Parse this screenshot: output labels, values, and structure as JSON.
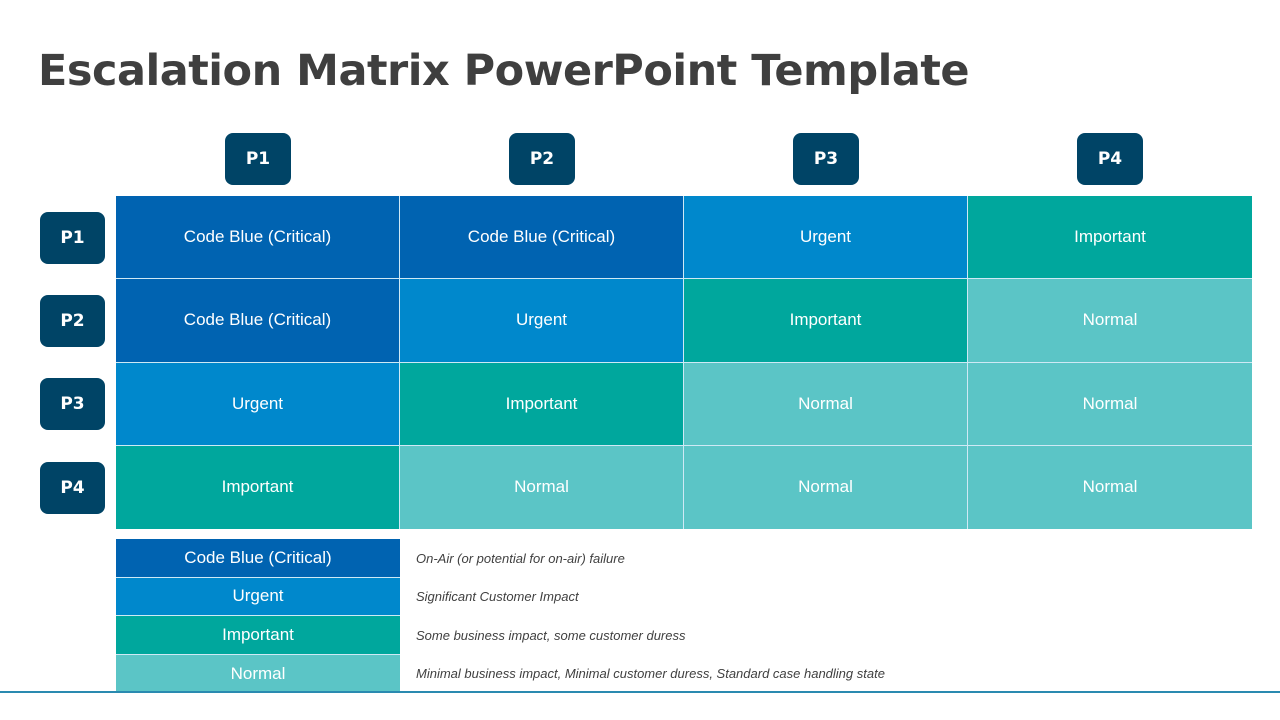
{
  "title": "Escalation Matrix PowerPoint Template",
  "colors": {
    "badge": "#004466",
    "code_blue": "#0063B1",
    "urgent": "#0088CC",
    "important": "#00A79D",
    "normal": "#5BC5C6"
  },
  "columns": [
    "P1",
    "P2",
    "P3",
    "P4"
  ],
  "rows": [
    "P1",
    "P2",
    "P3",
    "P4"
  ],
  "matrix": [
    [
      {
        "label": "Code Blue (Critical)",
        "level": "code_blue"
      },
      {
        "label": "Code Blue (Critical)",
        "level": "code_blue"
      },
      {
        "label": "Urgent",
        "level": "urgent"
      },
      {
        "label": "Important",
        "level": "important"
      }
    ],
    [
      {
        "label": "Code Blue (Critical)",
        "level": "code_blue"
      },
      {
        "label": "Urgent",
        "level": "urgent"
      },
      {
        "label": "Important",
        "level": "important"
      },
      {
        "label": "Normal",
        "level": "normal"
      }
    ],
    [
      {
        "label": "Urgent",
        "level": "urgent"
      },
      {
        "label": "Important",
        "level": "important"
      },
      {
        "label": "Normal",
        "level": "normal"
      },
      {
        "label": "Normal",
        "level": "normal"
      }
    ],
    [
      {
        "label": "Important",
        "level": "important"
      },
      {
        "label": "Normal",
        "level": "normal"
      },
      {
        "label": "Normal",
        "level": "normal"
      },
      {
        "label": "Normal",
        "level": "normal"
      }
    ]
  ],
  "legend": [
    {
      "label": "Code Blue (Critical)",
      "level": "code_blue",
      "description": "On-Air (or potential for on-air) failure"
    },
    {
      "label": "Urgent",
      "level": "urgent",
      "description": "Significant Customer Impact"
    },
    {
      "label": "Important",
      "level": "important",
      "description": "Some business impact, some customer duress"
    },
    {
      "label": "Normal",
      "level": "normal",
      "description": "Minimal business impact, Minimal customer duress, Standard case handling state"
    }
  ]
}
